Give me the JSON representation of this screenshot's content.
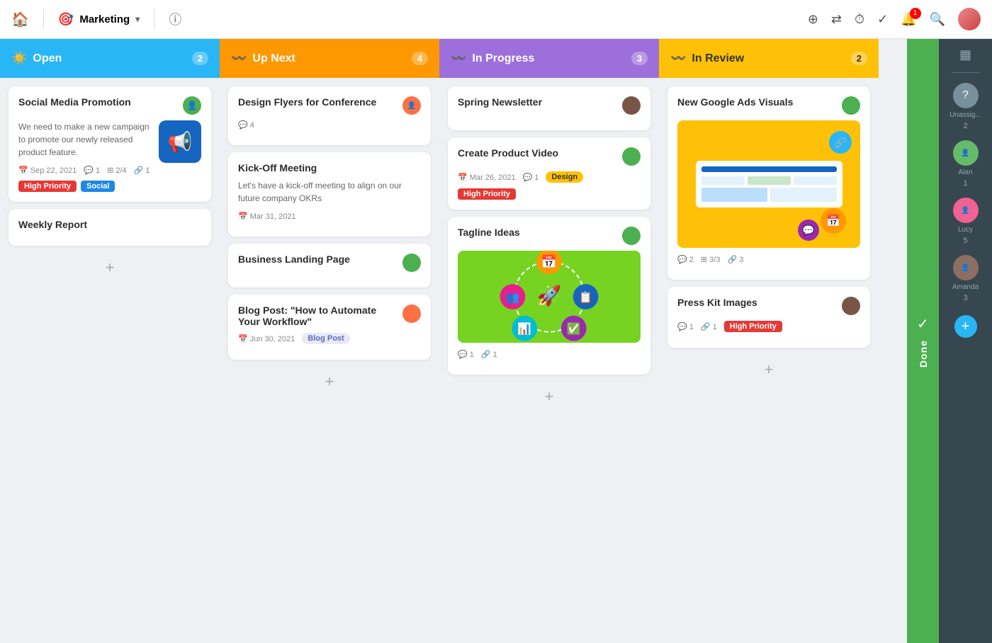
{
  "topnav": {
    "home_icon": "🏠",
    "brand_emoji": "🎯",
    "brand_name": "Marketing",
    "chevron": "▾",
    "info_icon": "ⓘ",
    "add_label": "+",
    "layout_icon": "⇌",
    "timer_icon": "⏱",
    "check_icon": "✓",
    "bell_icon": "🔔",
    "bell_badge": "1",
    "search_icon": "🔍"
  },
  "columns": {
    "open": {
      "label": "Open",
      "count": "2",
      "icon": "☀",
      "cards": [
        {
          "title": "Social Media Promotion",
          "desc": "We need to make a new campaign to promote our newly released product feature.",
          "avatar_color": "#4caf50",
          "date": "Sep 22, 2021",
          "comments": "1",
          "subtasks": "2/4",
          "attachments": "1",
          "tags": [
            "High Priority",
            "Social"
          ],
          "has_image": true
        },
        {
          "title": "Weekly Report",
          "desc": "",
          "avatar_color": null,
          "tags": []
        }
      ]
    },
    "upnext": {
      "label": "Up Next",
      "count": "4",
      "icon": "〜",
      "cards": [
        {
          "title": "Design Flyers for Conference",
          "comments": "4",
          "avatar_color": "#ff7043"
        },
        {
          "title": "Kick-Off Meeting",
          "desc": "Let's have a kick-off meeting to align on our future company OKRs",
          "date": "Mar 31, 2021",
          "avatar_color": null
        },
        {
          "title": "Business Landing Page",
          "avatar_color": "#4caf50"
        },
        {
          "title": "Blog Post: \"How to Automate Your Workflow\"",
          "date": "Jun 30, 2021",
          "tag": "Blog Post",
          "avatar_color": "#ff7043"
        }
      ]
    },
    "inprogress": {
      "label": "In Progress",
      "count": "3",
      "icon": "〜",
      "cards": [
        {
          "title": "Spring Newsletter",
          "avatar_color": "#795548"
        },
        {
          "title": "Create Product Video",
          "date": "Mar 26, 2021",
          "comments": "1",
          "tag_design": "Design",
          "tag_priority": "High Priority",
          "avatar_color": "#4caf50"
        },
        {
          "title": "Tagline Ideas",
          "comments": "1",
          "attachments": "1",
          "avatar_color": "#4caf50",
          "has_tagline_image": true
        }
      ]
    },
    "inreview": {
      "label": "In Review",
      "count": "2",
      "icon": "〜",
      "cards": [
        {
          "title": "New Google Ads Visuals",
          "comments": "2",
          "subtasks": "3/3",
          "attachments": "3",
          "avatar_color": "#4caf50",
          "has_ads_image": true
        },
        {
          "title": "Press Kit Images",
          "comments": "1",
          "attachments": "1",
          "tag_priority": "High Priority",
          "avatar_color": "#795548"
        }
      ]
    }
  },
  "done": {
    "label": "Done",
    "check_icon": "✓",
    "grid_icon": "▦"
  },
  "right_panel": {
    "unassigned_label": "Unassig...",
    "unassigned_count": "2",
    "alan_name": "Alan",
    "alan_count": "1",
    "lucy_name": "Lucy",
    "lucy_count": "5",
    "amanda_name": "Amanda",
    "amanda_count": "3",
    "add_icon": "+"
  }
}
